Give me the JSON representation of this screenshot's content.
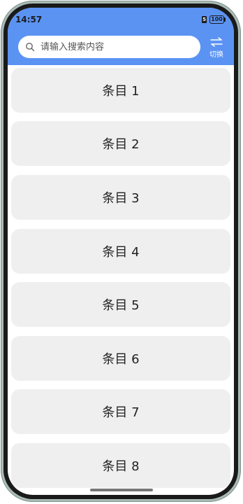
{
  "status_bar": {
    "time": "14:57",
    "sim_label": "5",
    "battery": "100"
  },
  "search": {
    "placeholder": "请输入搜索内容",
    "value": ""
  },
  "switch_button": {
    "label": "切换",
    "icon": "swap-arrows-icon"
  },
  "list": {
    "items": [
      {
        "label": "条目 1"
      },
      {
        "label": "条目 2"
      },
      {
        "label": "条目 3"
      },
      {
        "label": "条目 4"
      },
      {
        "label": "条目 5"
      },
      {
        "label": "条目 6"
      },
      {
        "label": "条目 7"
      },
      {
        "label": "条目 8"
      }
    ]
  },
  "colors": {
    "topbar": "#5b93f3",
    "item_bg": "#efefef",
    "frame": "#a9bbb6"
  }
}
